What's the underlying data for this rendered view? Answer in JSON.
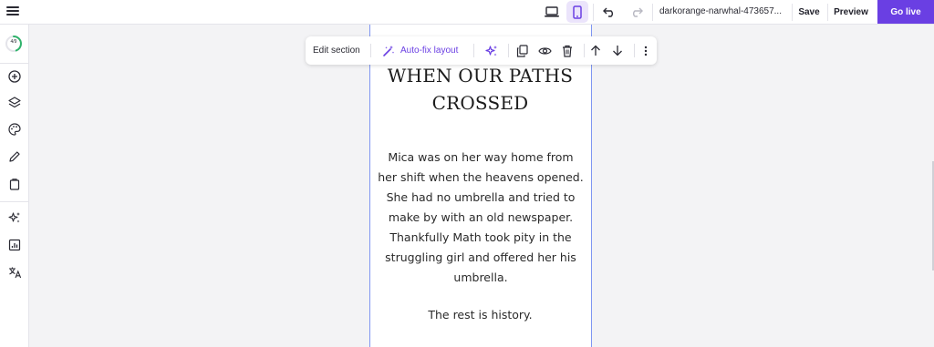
{
  "topbar": {
    "site_name": "darkorange-narwhal-473657...",
    "save_label": "Save",
    "preview_label": "Preview",
    "golive_label": "Go live"
  },
  "sidebar": {
    "progress_label": "4/9",
    "progress_fraction": 0.44,
    "items": [
      {
        "icon": "add-icon"
      },
      {
        "icon": "layers-icon"
      },
      {
        "icon": "palette-icon"
      },
      {
        "icon": "pencil-icon"
      },
      {
        "icon": "clipboard-icon"
      },
      {
        "icon": "sparkles-icon"
      },
      {
        "icon": "analytics-icon"
      },
      {
        "icon": "translate-icon"
      }
    ]
  },
  "toolbar": {
    "edit_section_label": "Edit section",
    "autofix_label": "Auto-fix layout"
  },
  "page": {
    "title_line1": "WHEN OUR PATHS",
    "title_line2": "CROSSED",
    "story": "Mica was on her way home from her shift when the heavens opened. She had no umbrella and tried to make by with an old newspaper. Thankfully Math took pity in the struggling girl and offered her his umbrella.",
    "ending": "The rest is history."
  },
  "colors": {
    "accent": "#6a3fe3",
    "selection_border": "#7f96f2",
    "mobile_active_bg": "#ebe4fb",
    "progress_green": "#2fb36b"
  }
}
